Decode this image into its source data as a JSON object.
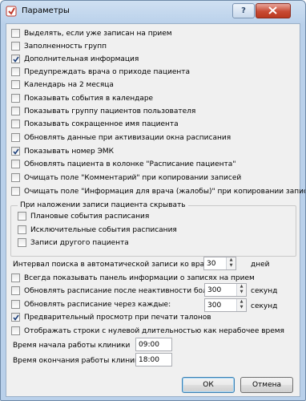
{
  "window": {
    "title": "Параметры"
  },
  "titlebar": {
    "help_label": "?"
  },
  "options": [
    {
      "label": "Выделять, если уже записан на прием",
      "checked": false
    },
    {
      "label": "Заполненность групп",
      "checked": false
    },
    {
      "label": "Дополнительная информация",
      "checked": true
    },
    {
      "label": "Предупреждать врача о приходе пациента",
      "checked": false
    },
    {
      "label": "Календарь на 2 месяца",
      "checked": false
    },
    {
      "label": "Показывать события в календаре",
      "checked": false
    },
    {
      "label": "Показывать группу пациентов пользователя",
      "checked": false
    },
    {
      "label": "Показывать сокращенное имя пациента",
      "checked": false
    },
    {
      "label": "Обновлять данные при активизации окна расписания",
      "checked": false
    },
    {
      "label": "Показывать номер ЭМК",
      "checked": true
    },
    {
      "label": "Обновлять пациента в колонке \"Расписание пациента\"",
      "checked": false
    },
    {
      "label": "Очищать поле \"Комментарий\" при копировании записей",
      "checked": false
    },
    {
      "label": "Очищать поле \"Информация для врача (жалобы)\" при копировании записей",
      "checked": false
    }
  ],
  "overlap_group": {
    "title": "При наложении записи пациента скрывать",
    "items": [
      {
        "label": "Плановые события расписания",
        "checked": false
      },
      {
        "label": "Исключительные события расписания",
        "checked": false
      },
      {
        "label": "Записи другого пациента",
        "checked": false
      }
    ]
  },
  "search_interval": {
    "label": "Интервал поиска в автоматической записи ко врачу:",
    "value": "30",
    "unit": "дней"
  },
  "info_panel": {
    "label": "Всегда показывать панель информации о записях на прием",
    "checked": false
  },
  "refresh_inactive": {
    "label": "Обновлять расписание после неактивности более:",
    "checked": false,
    "value": "300",
    "unit": "секунд"
  },
  "refresh_every": {
    "label": "Обновлять расписание через каждые:",
    "checked": false,
    "value": "300",
    "unit": "секунд"
  },
  "print_preview": {
    "label": "Предварительный просмотр при печати талонов",
    "checked": true
  },
  "zero_length": {
    "label": "Отображать строки с нулевой длительностью как нерабочее время",
    "checked": false
  },
  "clinic_start": {
    "label": "Время начала работы клиники",
    "value": "09:00"
  },
  "clinic_end": {
    "label": "Время окончания работы клиники",
    "value": "18:00"
  },
  "buttons": {
    "ok": "ОК",
    "cancel": "Отмена"
  }
}
